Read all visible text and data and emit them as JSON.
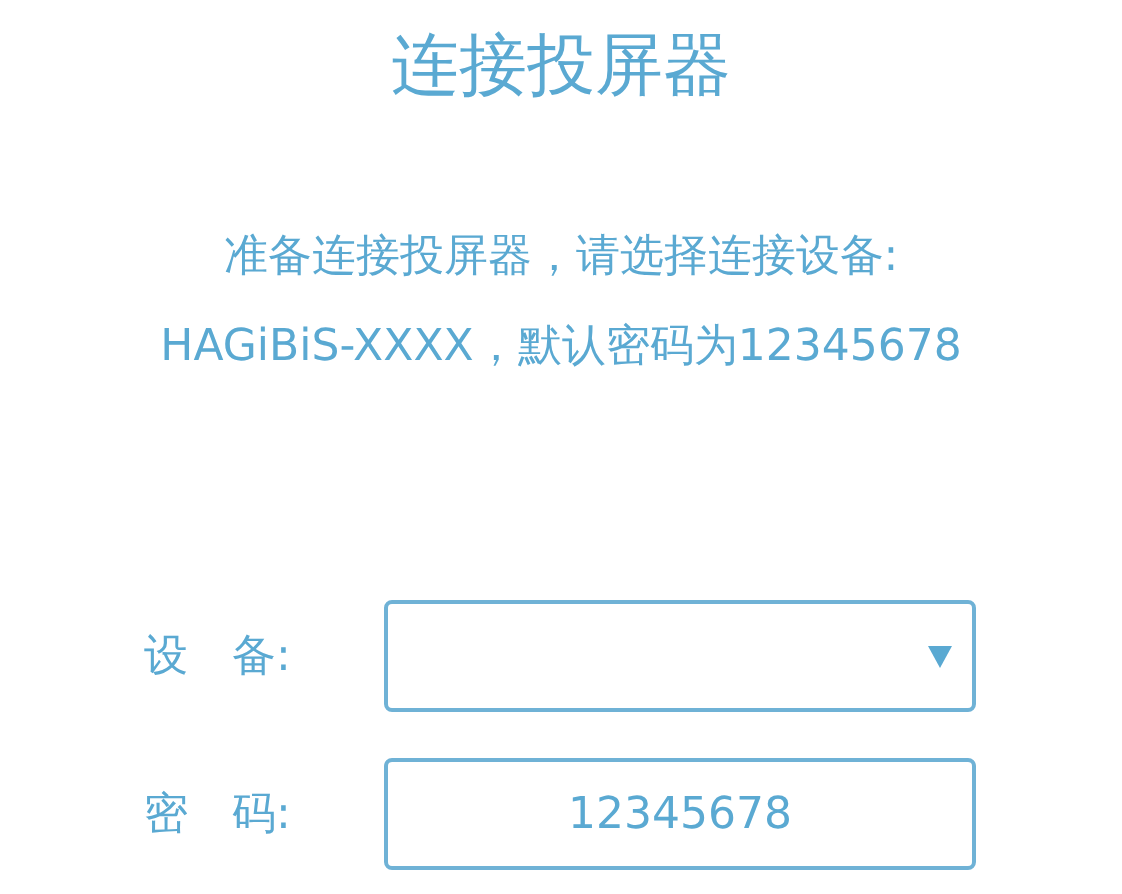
{
  "title": "连接投屏器",
  "instructions": [
    "准备连接投屏器，请选择连接设备:",
    "HAGiBiS-XXXX，默认密码为12345678"
  ],
  "fields": [
    {
      "kind": "dropdown",
      "label": "设　备:"
    },
    {
      "kind": "text",
      "label": "密　码:",
      "value": "12345678"
    }
  ]
}
